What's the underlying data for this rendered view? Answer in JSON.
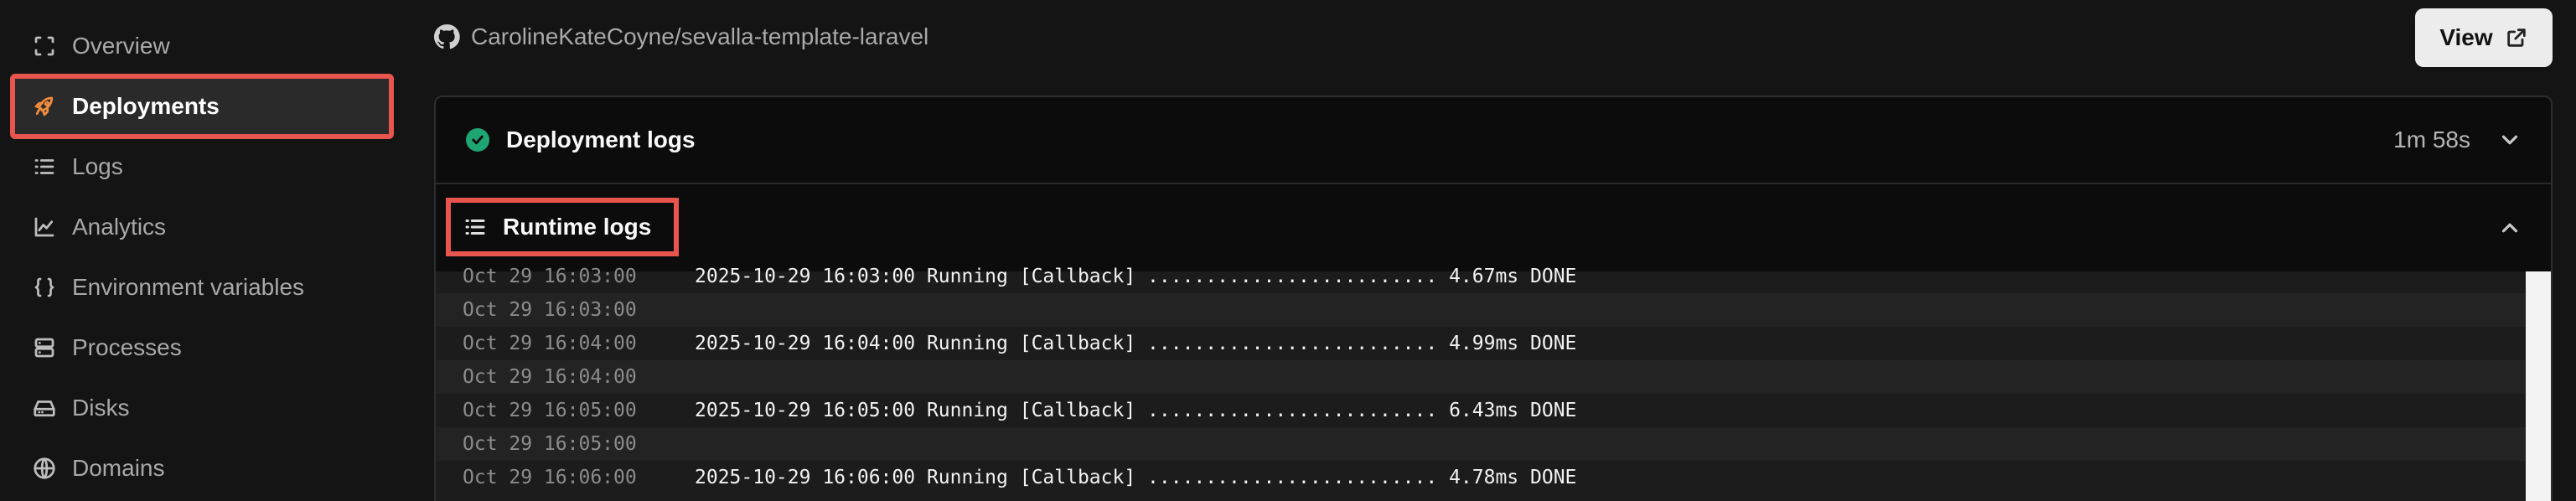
{
  "sidebar": {
    "items": [
      {
        "label": "Overview",
        "icon": "overview-icon"
      },
      {
        "label": "Deployments",
        "icon": "rocket-icon",
        "active": true
      },
      {
        "label": "Logs",
        "icon": "list-icon"
      },
      {
        "label": "Analytics",
        "icon": "chart-icon"
      },
      {
        "label": "Environment variables",
        "icon": "braces-icon"
      },
      {
        "label": "Processes",
        "icon": "server-icon"
      },
      {
        "label": "Disks",
        "icon": "disk-icon"
      },
      {
        "label": "Domains",
        "icon": "globe-icon"
      }
    ]
  },
  "header": {
    "repo": "CarolineKateCoyne/sevalla-template-laravel",
    "view_label": "View"
  },
  "deployment_logs": {
    "title": "Deployment logs",
    "duration": "1m 58s",
    "status_color": "#1ea672"
  },
  "runtime_logs": {
    "title": "Runtime logs",
    "rows": [
      {
        "ts": "Oct 29 16:03:00",
        "msg": "2025-10-29 16:03:00 Running [Callback] ......................... 4.67ms DONE"
      },
      {
        "ts": "Oct 29 16:03:00",
        "msg": ""
      },
      {
        "ts": "Oct 29 16:04:00",
        "msg": "2025-10-29 16:04:00 Running [Callback] ......................... 4.99ms DONE"
      },
      {
        "ts": "Oct 29 16:04:00",
        "msg": ""
      },
      {
        "ts": "Oct 29 16:05:00",
        "msg": "2025-10-29 16:05:00 Running [Callback] ......................... 6.43ms DONE"
      },
      {
        "ts": "Oct 29 16:05:00",
        "msg": ""
      },
      {
        "ts": "Oct 29 16:06:00",
        "msg": "2025-10-29 16:06:00 Running [Callback] ......................... 4.78ms DONE"
      }
    ]
  },
  "colors": {
    "highlight": "#e8554e",
    "accent": "#f28b3c"
  }
}
